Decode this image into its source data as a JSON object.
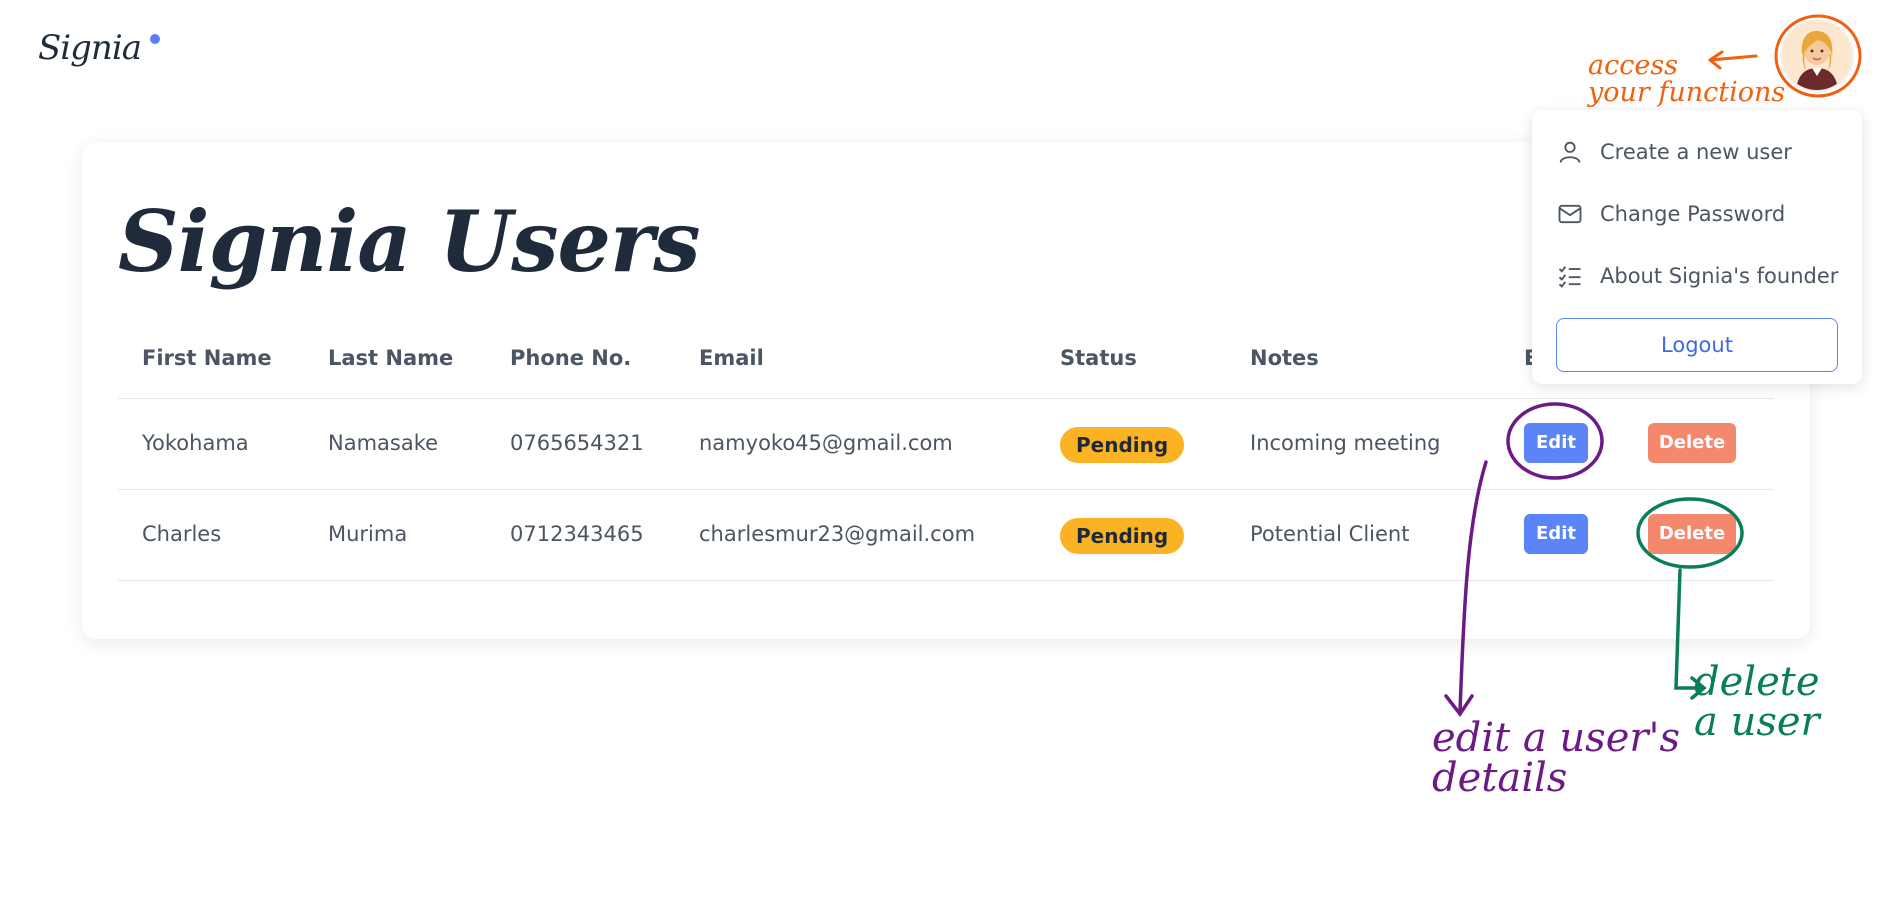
{
  "app": {
    "logo_text": "Signia"
  },
  "card": {
    "title": "Signia Users"
  },
  "table": {
    "headers": {
      "first_name": "First Name",
      "last_name": "Last Name",
      "phone": "Phone No.",
      "email": "Email",
      "status": "Status",
      "notes": "Notes",
      "actions_partial": "E"
    },
    "rows": [
      {
        "first_name": "Yokohama",
        "last_name": "Namasake",
        "phone": "0765654321",
        "email": "namyoko45@gmail.com",
        "status": "Pending",
        "notes": "Incoming meeting",
        "edit": "Edit",
        "delete": "Delete"
      },
      {
        "first_name": "Charles",
        "last_name": "Murima",
        "phone": "0712343465",
        "email": "charlesmur23@gmail.com",
        "status": "Pending",
        "notes": "Potential Client",
        "edit": "Edit",
        "delete": "Delete"
      }
    ]
  },
  "menu": {
    "items": [
      {
        "label": "Create a new user",
        "icon": "user-icon"
      },
      {
        "label": "Change Password",
        "icon": "mail-icon"
      },
      {
        "label": "About Signia's founder",
        "icon": "checklist-icon"
      }
    ],
    "logout": "Logout"
  },
  "annotations": {
    "orange": [
      "access",
      "your functions"
    ],
    "purple": [
      "edit a user's",
      "details"
    ],
    "green": [
      "delete",
      "a user"
    ]
  },
  "colors": {
    "accent": "#5b84f8",
    "status_pending": "#fbb324",
    "delete": "#f4886c",
    "annotation_orange": "#f2600e",
    "annotation_purple": "#6b1a86",
    "annotation_green": "#0a7f55"
  }
}
